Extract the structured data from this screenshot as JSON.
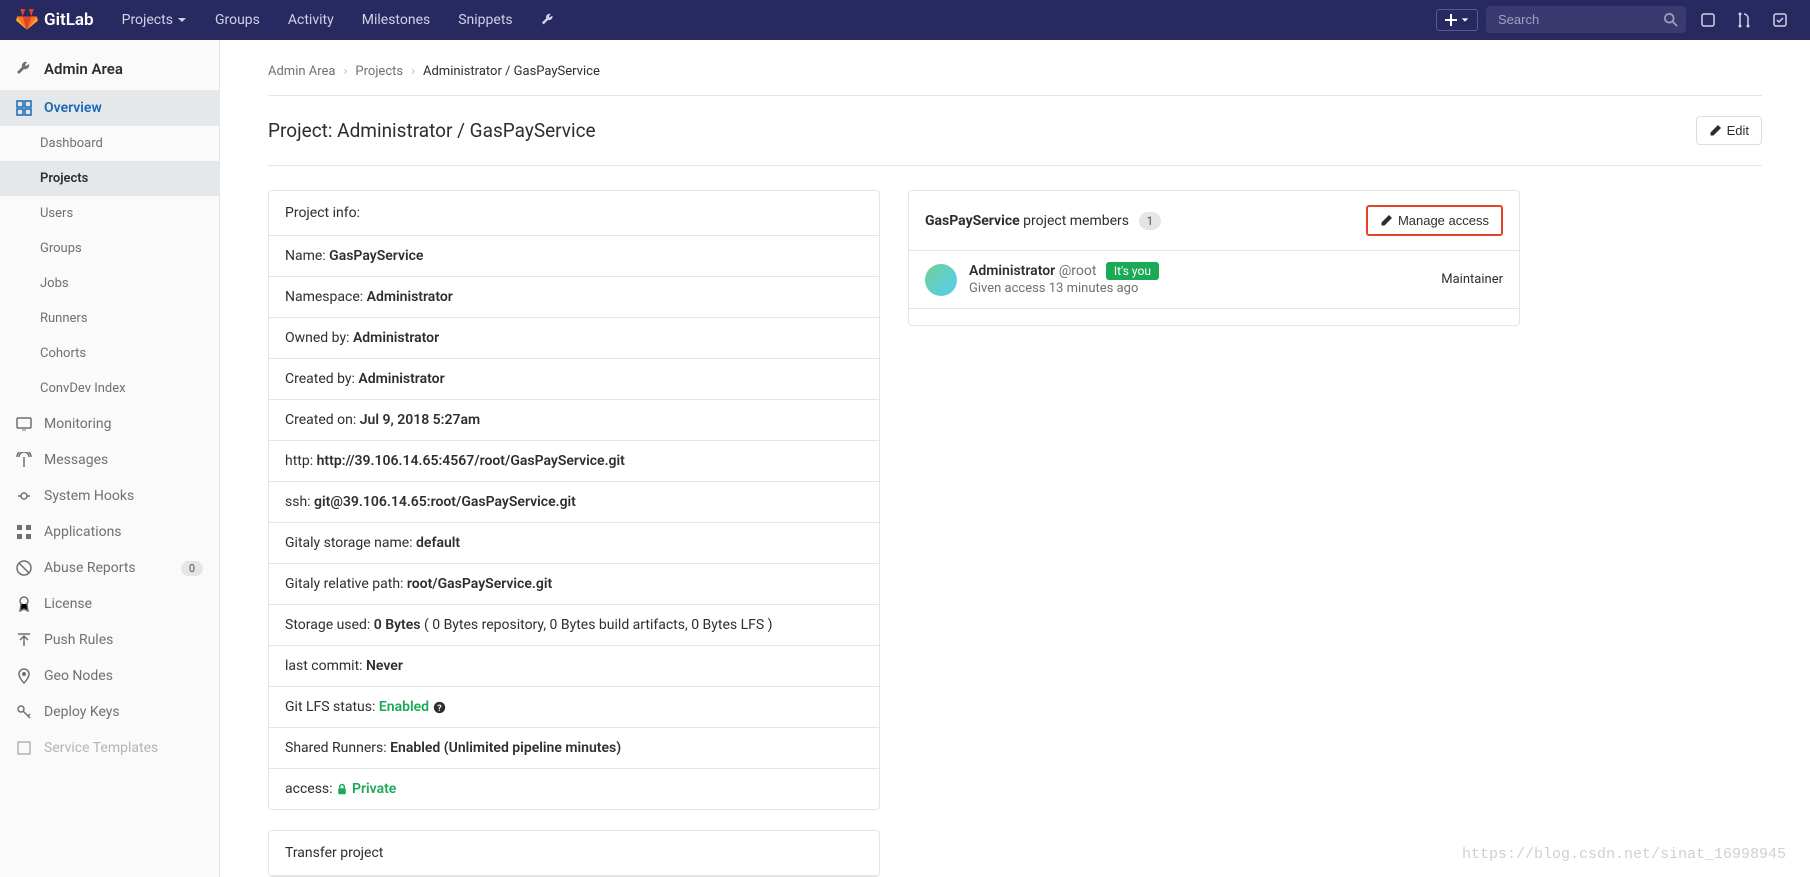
{
  "brand": "GitLab",
  "topnav": {
    "projects": "Projects",
    "groups": "Groups",
    "activity": "Activity",
    "milestones": "Milestones",
    "snippets": "Snippets"
  },
  "search": {
    "placeholder": "Search"
  },
  "sidebar": {
    "title": "Admin Area",
    "overview": "Overview",
    "subitems": {
      "dashboard": "Dashboard",
      "projects": "Projects",
      "users": "Users",
      "groups": "Groups",
      "jobs": "Jobs",
      "runners": "Runners",
      "cohorts": "Cohorts",
      "convdev": "ConvDev Index"
    },
    "monitoring": "Monitoring",
    "messages": "Messages",
    "system_hooks": "System Hooks",
    "applications": "Applications",
    "abuse_reports": "Abuse Reports",
    "abuse_count": "0",
    "license": "License",
    "push_rules": "Push Rules",
    "geo_nodes": "Geo Nodes",
    "deploy_keys": "Deploy Keys",
    "service_templates": "Service Templates"
  },
  "breadcrumb": {
    "admin": "Admin Area",
    "projects": "Projects",
    "current": "Administrator / GasPayService"
  },
  "page": {
    "title": "Project: Administrator / GasPayService",
    "edit": "Edit"
  },
  "info": {
    "header": "Project info:",
    "name_label": "Name: ",
    "name": "GasPayService",
    "namespace_label": "Namespace: ",
    "namespace": "Administrator",
    "owned_label": "Owned by: ",
    "owned": "Administrator",
    "created_by_label": "Created by: ",
    "created_by": "Administrator",
    "created_on_label": "Created on: ",
    "created_on": "Jul 9, 2018 5:27am",
    "http_label": "http: ",
    "http": "http://39.106.14.65:4567/root/GasPayService.git",
    "ssh_label": "ssh: ",
    "ssh": "git@39.106.14.65:root/GasPayService.git",
    "gitaly_storage_label": "Gitaly storage name: ",
    "gitaly_storage": "default",
    "gitaly_path_label": "Gitaly relative path: ",
    "gitaly_path": "root/GasPayService.git",
    "storage_label": "Storage used: ",
    "storage": "0 Bytes",
    "storage_detail": " ( 0 Bytes repository, 0 Bytes build artifacts, 0 Bytes LFS )",
    "last_commit_label": "last commit: ",
    "last_commit": "Never",
    "lfs_label": "Git LFS status: ",
    "lfs": "Enabled",
    "shared_label": "Shared Runners: ",
    "shared": "Enabled (Unlimited pipeline minutes)",
    "access_label": "access: ",
    "access": "Private"
  },
  "transfer": {
    "header": "Transfer project"
  },
  "members": {
    "project": "GasPayService",
    "suffix": " project members",
    "count": "1",
    "manage": "Manage access",
    "member": {
      "name": "Administrator",
      "user": "@root",
      "you": "It's you",
      "given": "Given access 13 minutes ago",
      "role": "Maintainer"
    }
  },
  "watermark": "https://blog.csdn.net/sinat_16998945"
}
